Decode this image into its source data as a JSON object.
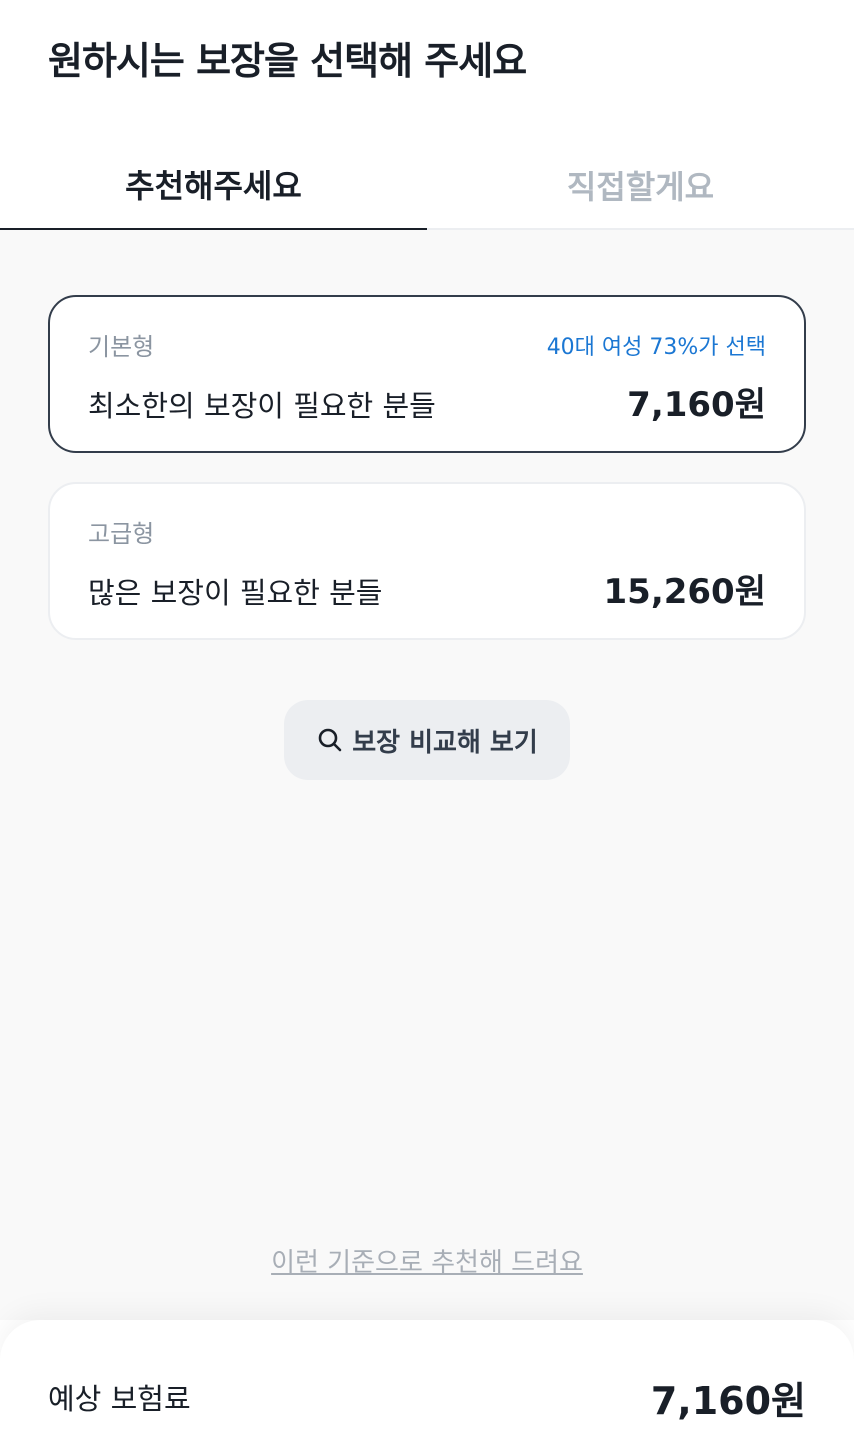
{
  "header": {
    "title": "원하시는 보장을 선택해 주세요"
  },
  "tabs": [
    {
      "label": "추천해주세요",
      "active": true
    },
    {
      "label": "직접할게요",
      "active": false
    }
  ],
  "plans": [
    {
      "name": "기본형",
      "badge": "40대 여성 73%가 선택",
      "description": "최소한의 보장이 필요한 분들",
      "price": "7,160원",
      "selected": true
    },
    {
      "name": "고급형",
      "description": "많은 보장이 필요한 분들",
      "price": "15,260원",
      "selected": false
    }
  ],
  "compare_button": {
    "label": "보장 비교해 보기",
    "icon": "search-icon"
  },
  "criteria_link": "이런 기준으로 추천해 드려요",
  "summary": {
    "label": "예상 보험료",
    "value": "7,160원"
  },
  "colors": {
    "text_primary": "#191f28",
    "text_secondary": "#8b95a1",
    "text_disabled": "#b0b8c1",
    "accent_blue": "#1b77d3",
    "background": "#f9f9f9"
  }
}
